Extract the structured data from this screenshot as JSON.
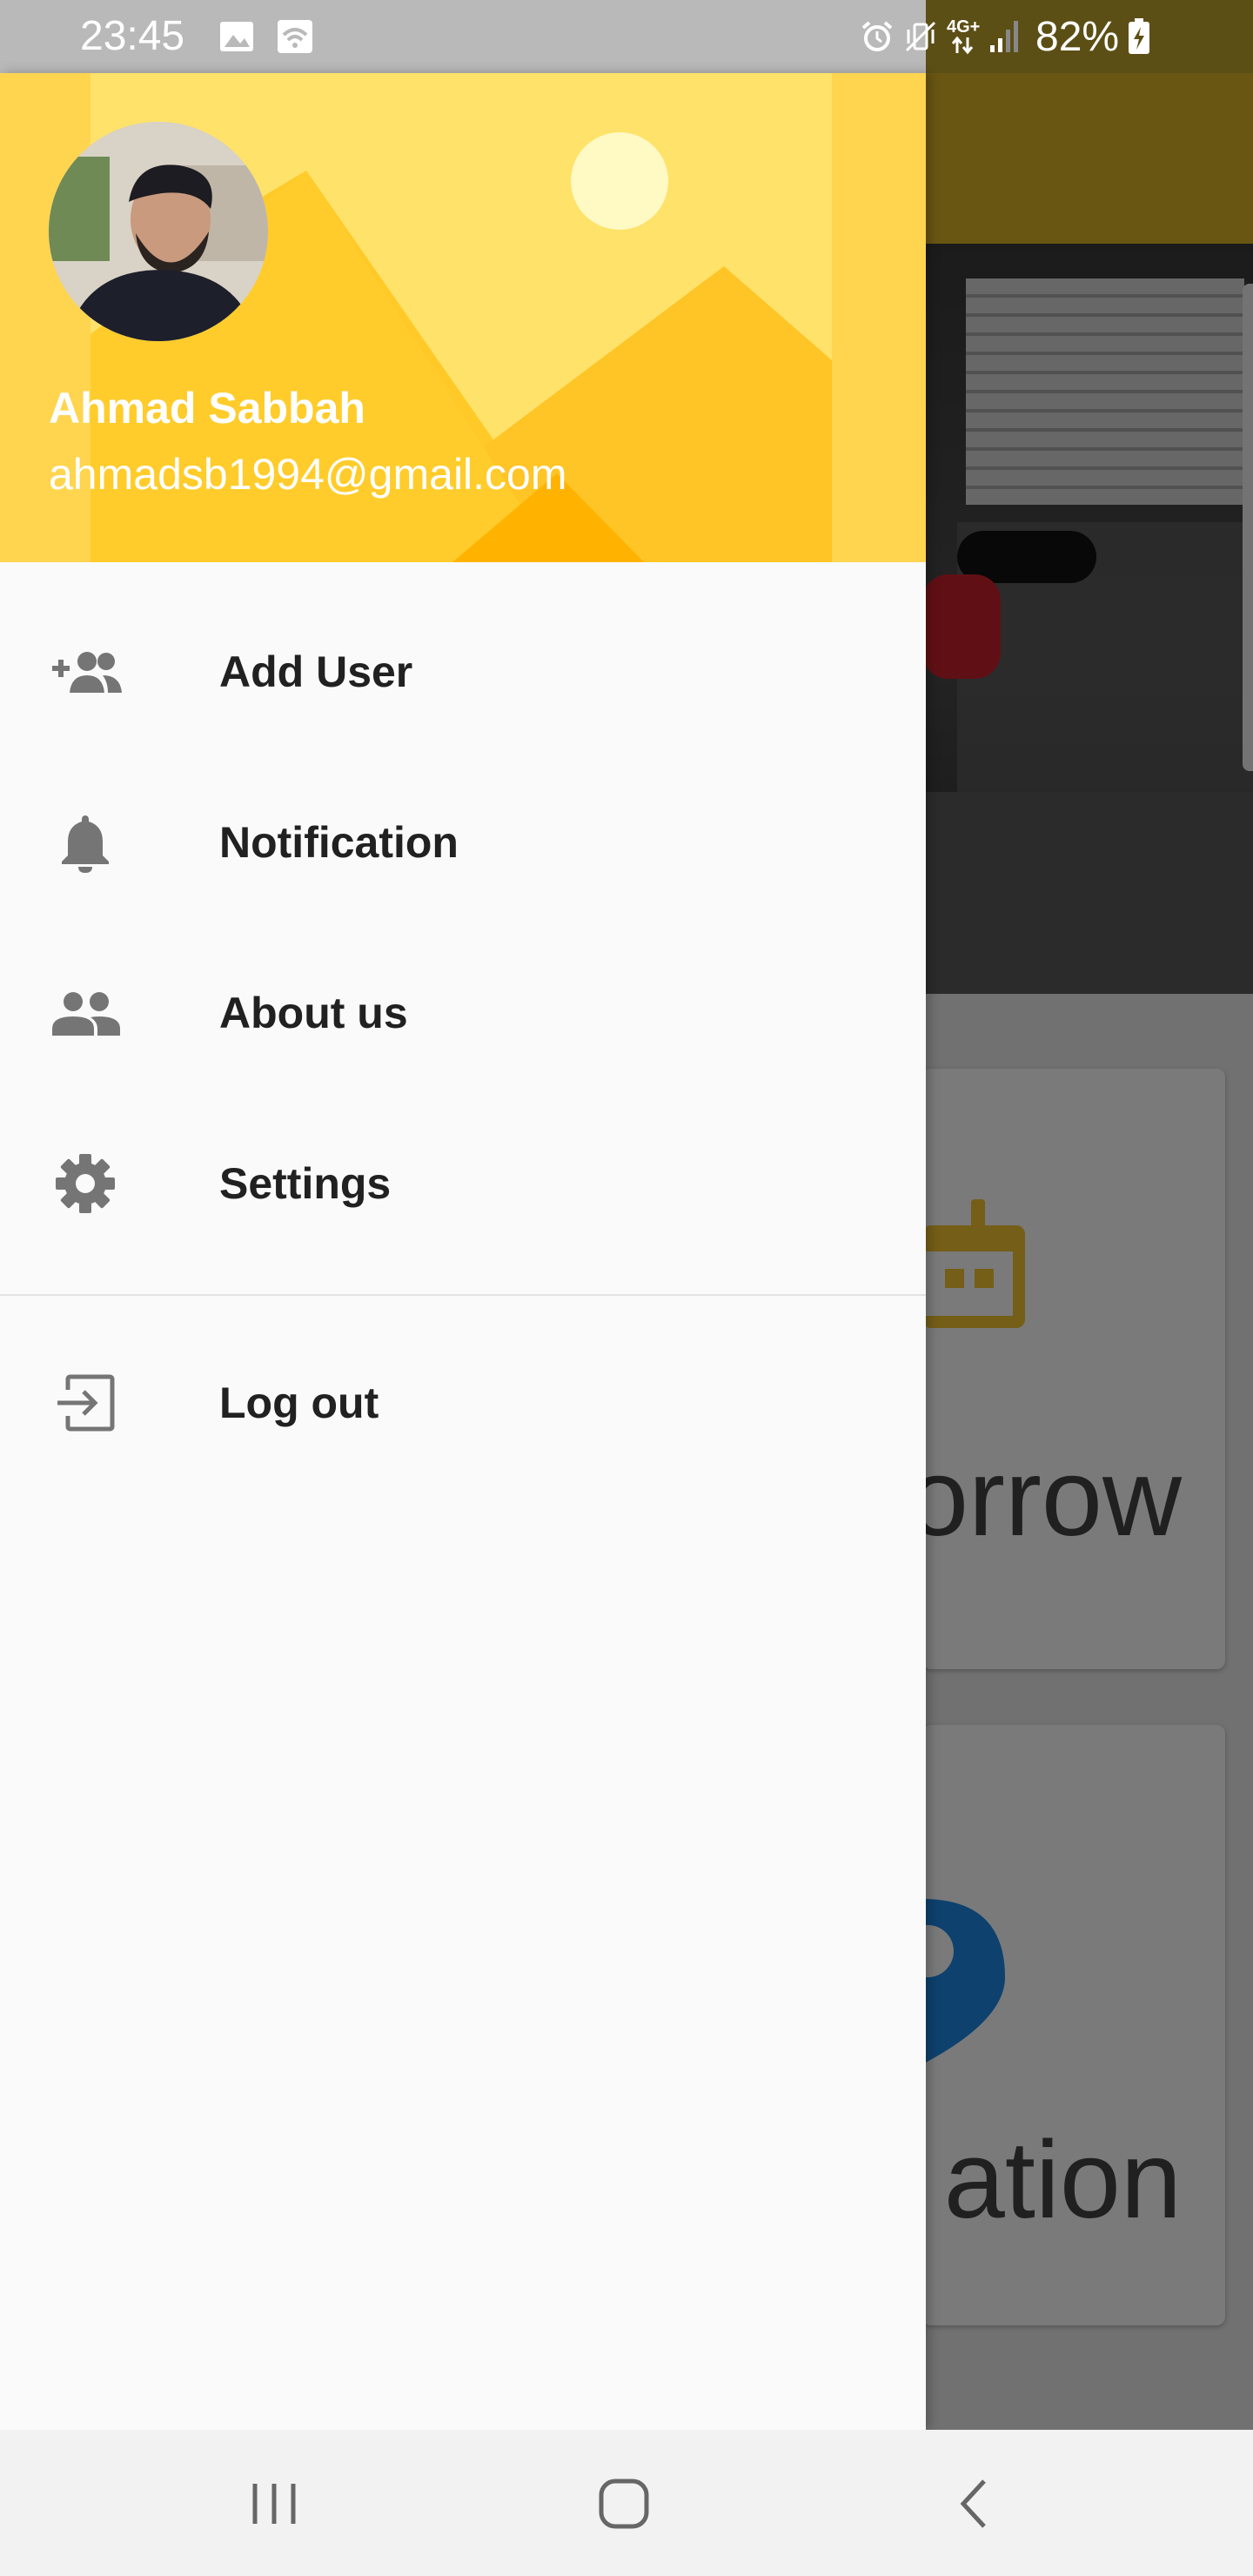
{
  "status_bar": {
    "time": "23:45",
    "network": "4G+",
    "battery": "82%",
    "icons": [
      "image-icon",
      "wifi-icon",
      "alarm-icon",
      "vibrate-icon",
      "data-arrows-icon",
      "signal-icon",
      "battery-charging-icon"
    ]
  },
  "drawer": {
    "header": {
      "user_name": "Ahmad Sabbah",
      "user_email": "ahmadsb1994@gmail.com"
    },
    "items": [
      {
        "label": "Add User",
        "icon": "add-group-icon"
      },
      {
        "label": "Notification",
        "icon": "bell-icon"
      },
      {
        "label": "About us",
        "icon": "people-icon"
      },
      {
        "label": "Settings",
        "icon": "gear-icon"
      },
      {
        "label": "Log out",
        "icon": "logout-icon"
      }
    ]
  },
  "background": {
    "card_1_text": "orrow",
    "card_2_text": "ation"
  },
  "nav_bar": {
    "buttons": [
      "recents-icon",
      "home-icon",
      "back-icon"
    ]
  },
  "colors": {
    "header_yellow": "#ffd347",
    "app_bar": "#dcb428",
    "drawer_bg": "#fafafa",
    "icon_gray": "#757575",
    "text_dark": "#212121",
    "pin_blue": "#1e88e5"
  }
}
